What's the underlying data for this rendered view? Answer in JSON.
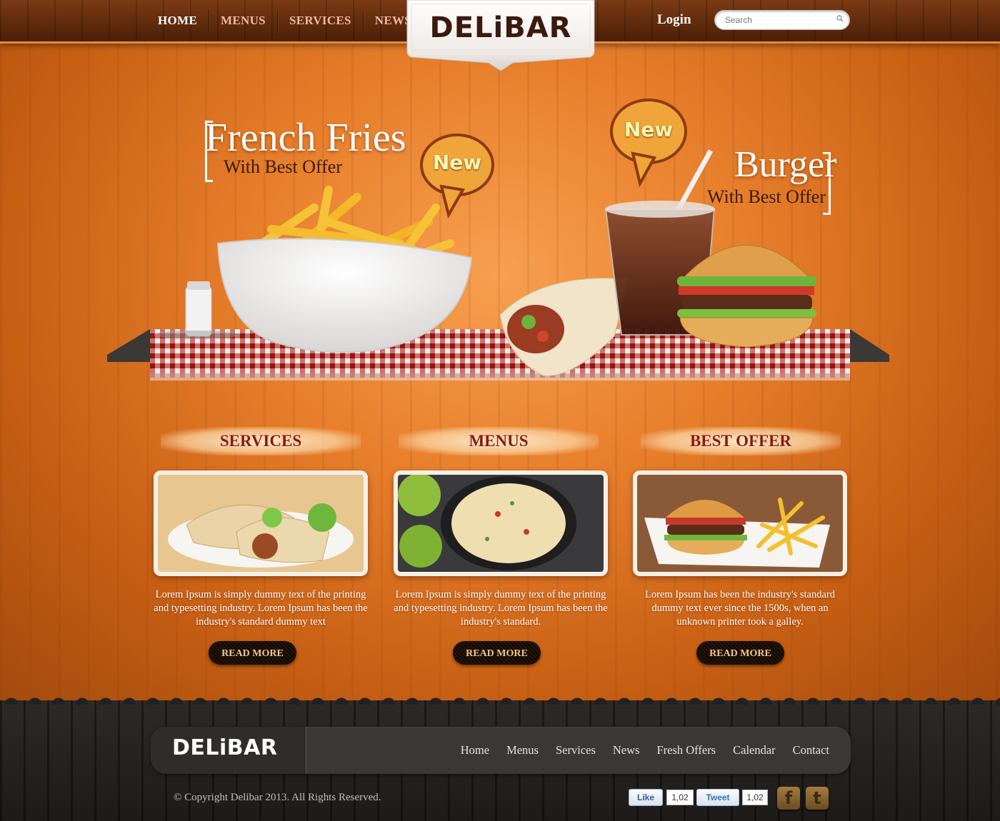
{
  "nav": {
    "items": [
      {
        "label": "HOME",
        "active": true
      },
      {
        "label": "MENUS"
      },
      {
        "label": "SERVICES"
      },
      {
        "label": "NEWS"
      }
    ],
    "login": "Login",
    "search_placeholder": "Search"
  },
  "logo": "DELiBAR",
  "hero": {
    "left_title": "French Fries",
    "left_subtitle": "With Best Offer",
    "left_badge": "New",
    "right_title": "Burger",
    "right_subtitle": "With Best Offer",
    "right_badge": "New"
  },
  "sections": [
    {
      "heading": "SERVICES",
      "text": "Lorem Ipsum is simply dummy text of the printing and typesetting industry. Lorem Ipsum has been the industry's standard dummy text",
      "button": "READ MORE",
      "image": "pita-wraps-photo"
    },
    {
      "heading": "MENUS",
      "text": "Lorem Ipsum is simply dummy text of the printing and typesetting industry. Lorem Ipsum has been the industry's standard.",
      "button": "READ MORE",
      "image": "rice-pan-photo"
    },
    {
      "heading": "BEST OFFER",
      "text": "Lorem Ipsum has been the industry's standard dummy text  ever since the 1500s, when an unknown printer took a galley.",
      "button": "READ MORE",
      "image": "burger-fries-photo"
    }
  ],
  "footer": {
    "logo": "DELiBAR",
    "nav": [
      "Home",
      "Menus",
      "Services",
      "News",
      "Fresh Offers",
      "Calendar",
      "Contact"
    ],
    "copyright": "© Copyright Delibar 2013. All Rights Reserved.",
    "like_label": "Like",
    "like_count": "1,02",
    "tweet_label": "Tweet",
    "tweet_count": "1,02",
    "social_icons": [
      "facebook-icon",
      "twitter-icon"
    ]
  },
  "colors": {
    "accent_orange": "#e77f2c",
    "nav_wood": "#5e2a0c",
    "heading_red": "#8a1a0e",
    "footer_dark": "#1d1b1a"
  }
}
